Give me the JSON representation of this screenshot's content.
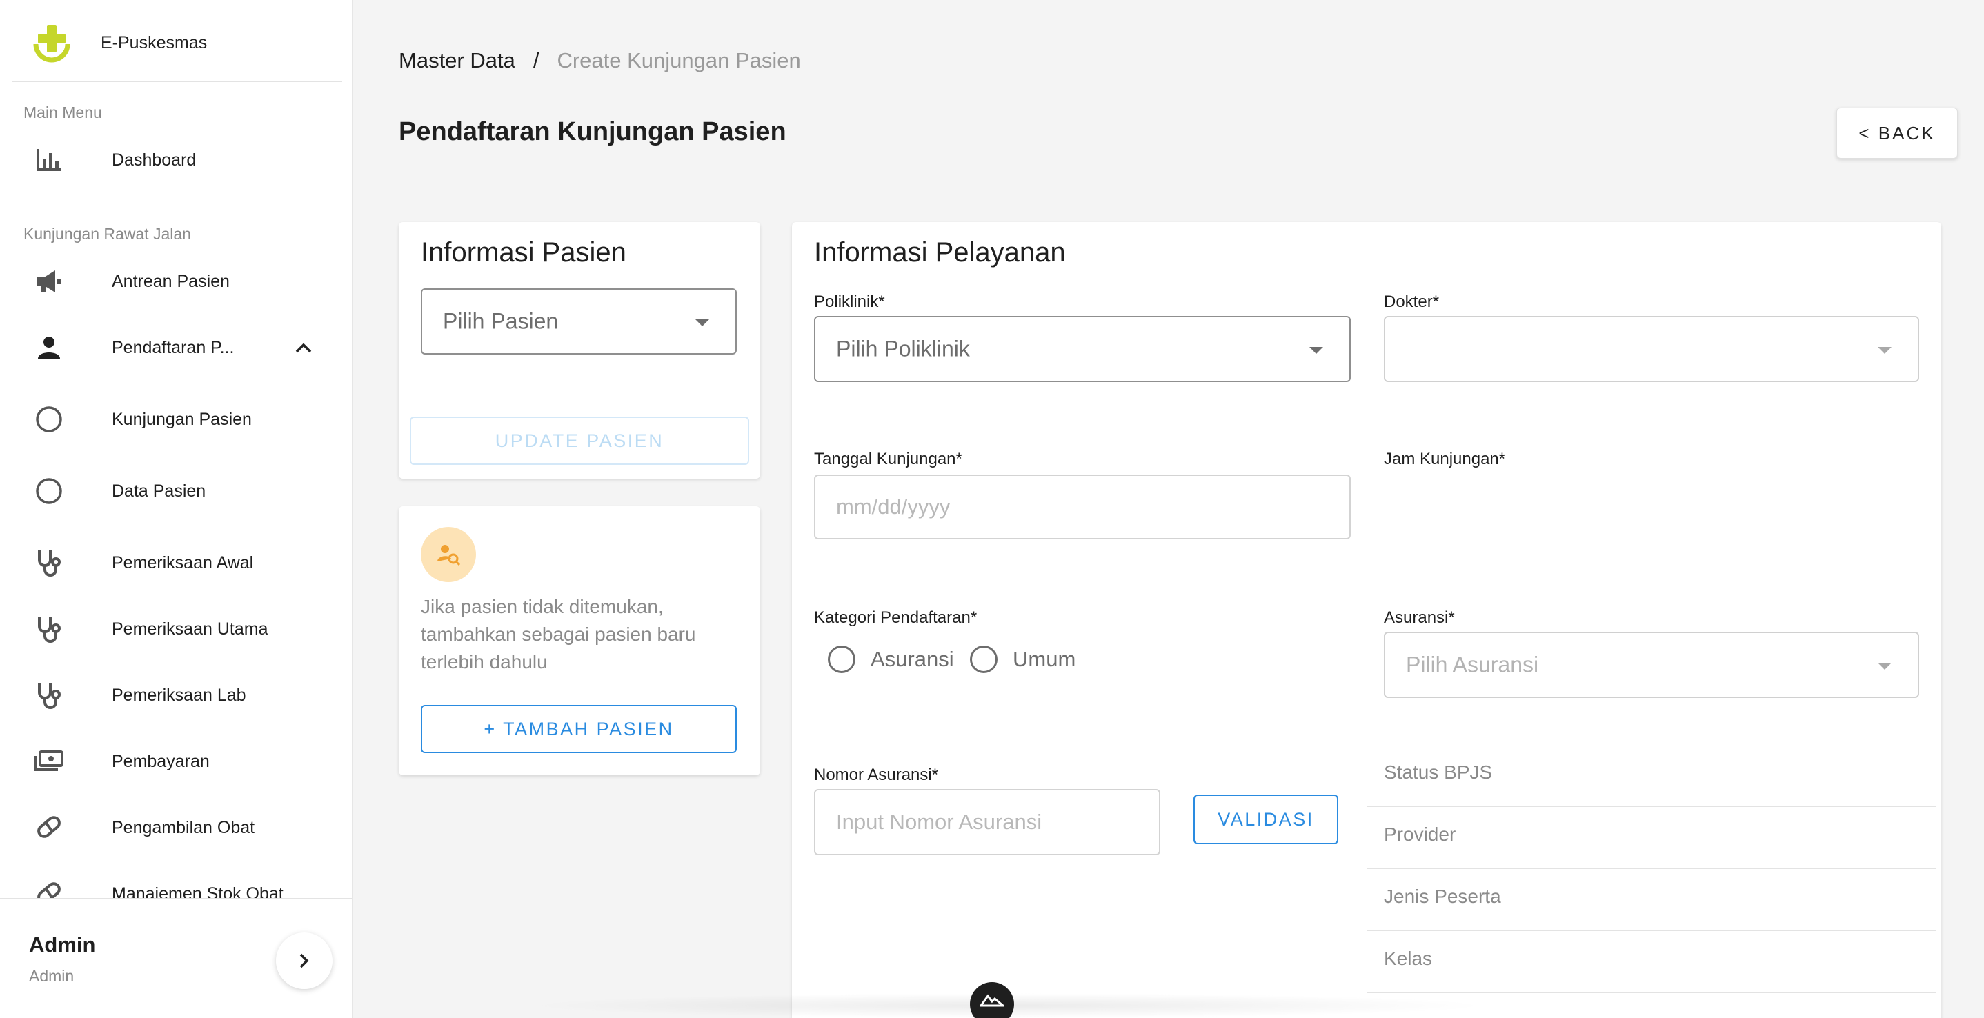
{
  "sidebar": {
    "brand": "E-Puskesmas",
    "main_menu_label": "Main Menu",
    "rawat_jalan_label": "Kunjungan Rawat Jalan",
    "items": [
      {
        "label": "Dashboard",
        "icon": "bar-chart-icon"
      },
      {
        "label": "Antrean Pasien",
        "icon": "megaphone-icon"
      },
      {
        "label": "Pendaftaran P...",
        "icon": "person-icon"
      },
      {
        "label": "Kunjungan Pasien",
        "icon": "circle-icon"
      },
      {
        "label": "Data Pasien",
        "icon": "circle-icon"
      },
      {
        "label": "Pemeriksaan Awal",
        "icon": "stethoscope-icon"
      },
      {
        "label": "Pemeriksaan Utama",
        "icon": "stethoscope-icon"
      },
      {
        "label": "Pemeriksaan Lab",
        "icon": "stethoscope-icon"
      },
      {
        "label": "Pembayaran",
        "icon": "money-icon"
      },
      {
        "label": "Pengambilan Obat",
        "icon": "pill-icon"
      },
      {
        "label": "Manajemen Stok Obat",
        "icon": "pill-icon"
      }
    ],
    "footer": {
      "name": "Admin",
      "role": "Admin"
    }
  },
  "breadcrumb": {
    "root": "Master Data",
    "separator": "/",
    "current": "Create Kunjungan Pasien"
  },
  "page_title": "Pendaftaran Kunjungan Pasien",
  "back_button": "< BACK",
  "patient_card": {
    "title": "Informasi Pasien",
    "select_placeholder": "Pilih Pasien",
    "update_button": "UPDATE PASIEN"
  },
  "hint_card": {
    "text": "Jika pasien tidak ditemukan, tambahkan sebagai pasien baru terlebih dahulu",
    "add_button": "+ TAMBAH PASIEN"
  },
  "service_card": {
    "title": "Informasi Pelayanan",
    "poliklinik_label": "Poliklinik*",
    "poliklinik_placeholder": "Pilih Poliklinik",
    "dokter_label": "Dokter*",
    "dokter_value": "",
    "tanggal_label": "Tanggal Kunjungan*",
    "tanggal_placeholder": "mm/dd/yyyy",
    "jam_label": "Jam Kunjungan*",
    "kategori_label": "Kategori Pendaftaran*",
    "kategori_options": [
      "Asuransi",
      "Umum"
    ],
    "asuransi_label": "Asuransi*",
    "asuransi_placeholder": "Pilih Asuransi",
    "nomor_label": "Nomor Asuransi*",
    "nomor_placeholder": "Input Nomor Asuransi",
    "validasi_button": "VALIDASI",
    "bpjs_rows": [
      "Status BPJS",
      "Provider",
      "Jenis Peserta",
      "Kelas"
    ]
  },
  "colors": {
    "accent": "#2a8be0",
    "brand_green": "#c5d62b",
    "hint_bg": "#fde3b6",
    "hint_icon": "#f0a030"
  }
}
